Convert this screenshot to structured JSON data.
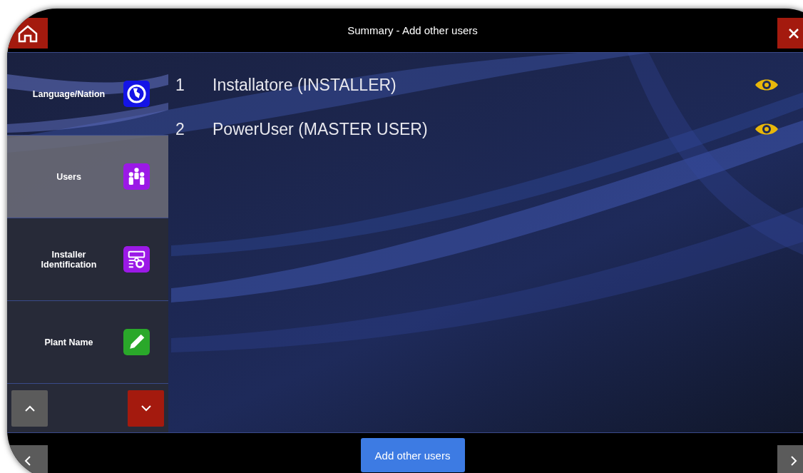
{
  "window": {
    "title": "Summary - Add other users"
  },
  "sidebar": {
    "items": [
      {
        "label": "Language/Nation",
        "kind": "globe",
        "selected": false
      },
      {
        "label": "Users",
        "kind": "users",
        "selected": true
      },
      {
        "label": "Installer Identification",
        "kind": "installer",
        "selected": false
      },
      {
        "label": "Plant Name",
        "kind": "pencil",
        "selected": false
      }
    ]
  },
  "users": [
    {
      "number": "1",
      "name": "Installatore (INSTALLER)"
    },
    {
      "number": "2",
      "name": "PowerUser (MASTER USER)"
    }
  ],
  "footer": {
    "button": "Add other users"
  }
}
